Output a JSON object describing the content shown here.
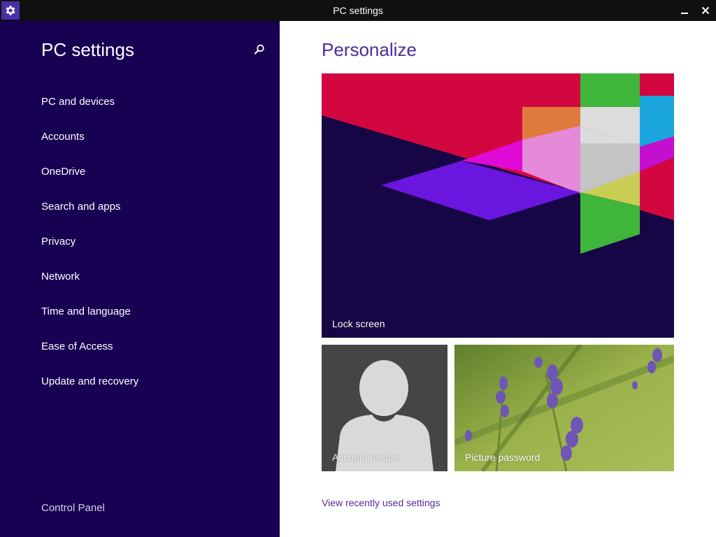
{
  "window": {
    "title": "PC settings"
  },
  "sidebar": {
    "title": "PC settings",
    "items": [
      {
        "label": "PC and devices"
      },
      {
        "label": "Accounts"
      },
      {
        "label": "OneDrive"
      },
      {
        "label": "Search and apps"
      },
      {
        "label": "Privacy"
      },
      {
        "label": "Network"
      },
      {
        "label": "Time and language"
      },
      {
        "label": "Ease of Access"
      },
      {
        "label": "Update and recovery"
      }
    ],
    "footer_link": "Control Panel"
  },
  "main": {
    "title": "Personalize",
    "tiles": {
      "lock_screen": "Lock screen",
      "account_picture": "Account picture",
      "picture_password": "Picture password"
    },
    "link": "View recently used settings"
  },
  "icons": {
    "app": "gear-icon",
    "minimize": "minimize-icon",
    "close": "close-icon",
    "search": "search-icon"
  },
  "colors": {
    "sidebar_bg": "#180052",
    "accent": "#4b2c9f",
    "titlebar_bg": "#101010"
  }
}
